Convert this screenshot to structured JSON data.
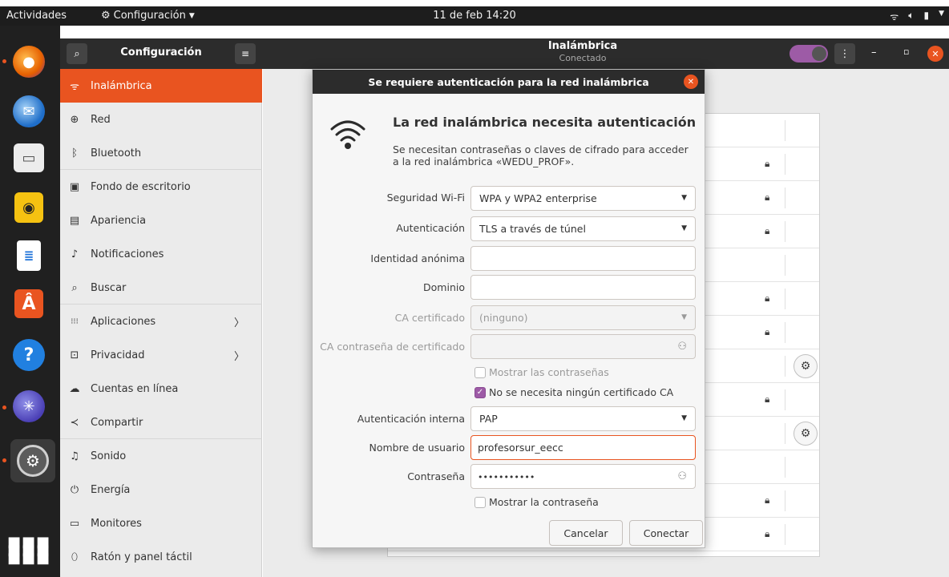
{
  "topbar": {
    "activities": "Actividades",
    "app_menu": "Configuración",
    "clock": "11 de feb  14:20"
  },
  "sidebar_header": {
    "title": "Configuración"
  },
  "main_header": {
    "title": "Inalámbrica",
    "subtitle": "Conectado"
  },
  "sidebar": {
    "items": [
      {
        "label": "Inalámbrica",
        "icon": "wifi-icon",
        "glyph": "ᯤ"
      },
      {
        "label": "Red",
        "icon": "network-icon",
        "glyph": "⊕"
      },
      {
        "label": "Bluetooth",
        "icon": "bluetooth-icon",
        "glyph": "ᛒ"
      },
      {
        "label": "Fondo de escritorio",
        "icon": "wallpaper-icon",
        "glyph": "▣"
      },
      {
        "label": "Apariencia",
        "icon": "appearance-icon",
        "glyph": "▤"
      },
      {
        "label": "Notificaciones",
        "icon": "bell-icon",
        "glyph": "♫"
      },
      {
        "label": "Buscar",
        "icon": "search-icon",
        "glyph": "⌕"
      },
      {
        "label": "Aplicaciones",
        "icon": "apps-icon",
        "glyph": "⁞⁞⁞"
      },
      {
        "label": "Privacidad",
        "icon": "lock-icon",
        "glyph": "⊡"
      },
      {
        "label": "Cuentas en línea",
        "icon": "cloud-icon",
        "glyph": "☁"
      },
      {
        "label": "Compartir",
        "icon": "share-icon",
        "glyph": "≺"
      },
      {
        "label": "Sonido",
        "icon": "music-note-icon",
        "glyph": "♫"
      },
      {
        "label": "Energía",
        "icon": "power-icon",
        "glyph": "⏻"
      },
      {
        "label": "Monitores",
        "icon": "monitor-icon",
        "glyph": "▭"
      },
      {
        "label": "Ratón y panel táctil",
        "icon": "mouse-icon",
        "glyph": "⬯"
      }
    ]
  },
  "dialog": {
    "title": "Se requiere autenticación para la red inalámbrica",
    "heading": "La red inalámbrica necesita autenticación",
    "description": "Se necesitan contraseñas o claves de cifrado para acceder a la red inalámbrica «WEDU_PROF».",
    "fields": {
      "security_label": "Seguridad Wi-Fi",
      "security_value": "WPA y WPA2 enterprise",
      "auth_label": "Autenticación",
      "auth_value": "TLS a través de túnel",
      "anon_identity_label": "Identidad anónima",
      "anon_identity_value": "",
      "domain_label": "Dominio",
      "domain_value": "",
      "ca_cert_label": "CA certificado",
      "ca_cert_value": "(ninguno)",
      "ca_password_label": "CA contraseña de certificado",
      "ca_password_value": "",
      "show_passwords_label": "Mostrar las contraseñas",
      "no_ca_label": "No se necesita ningún certificado CA",
      "inner_auth_label": "Autenticación interna",
      "inner_auth_value": "PAP",
      "username_label": "Nombre de usuario",
      "username_value": "profesorsur_eecc",
      "password_label": "Contraseña",
      "password_value": "•••••••••••",
      "show_password_label": "Mostrar la contraseña"
    },
    "buttons": {
      "cancel": "Cancelar",
      "connect": "Conectar"
    }
  },
  "colors": {
    "accent": "#e95420",
    "check": "#9d5ba6",
    "dark": "#2c2c2c"
  }
}
